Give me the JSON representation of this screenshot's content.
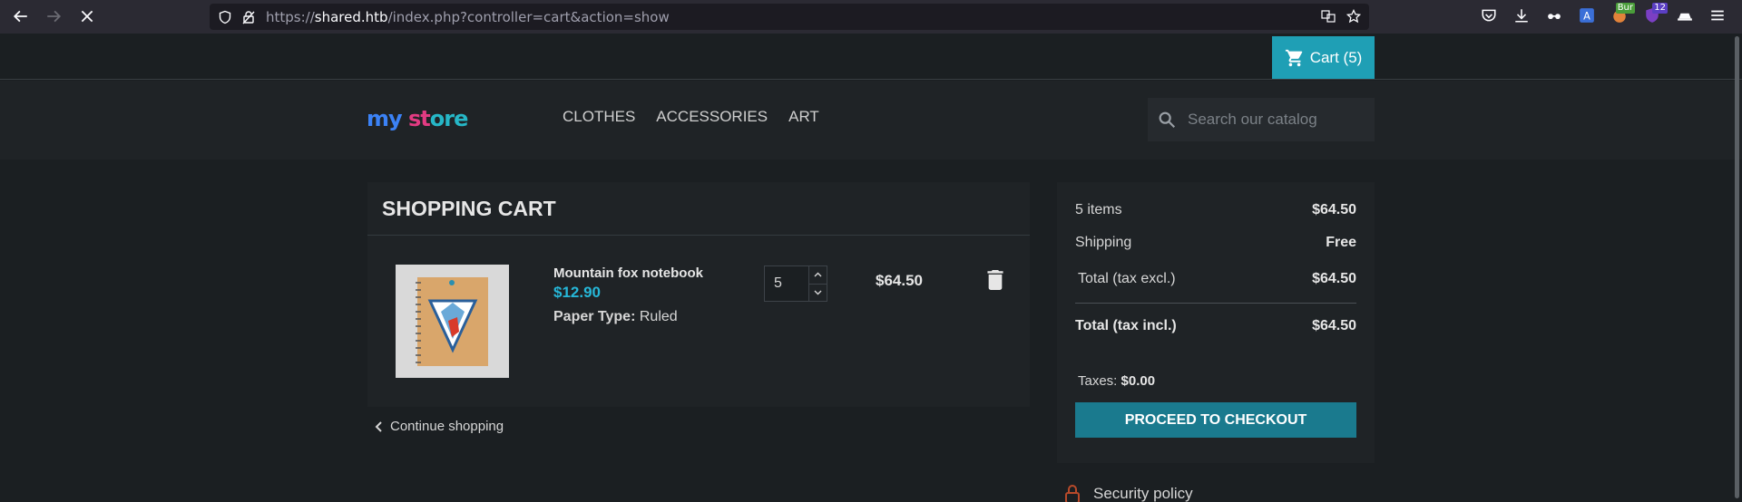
{
  "browser": {
    "url_prefix": "https://",
    "url_host": "shared.htb",
    "url_path": "/index.php?controller=cart&action=show",
    "ext_badge_bur": "Bur",
    "ext_badge_count": "12"
  },
  "topbar": {
    "cart_label": "Cart (5)"
  },
  "header": {
    "logo": {
      "p1": "my",
      "p2": " ",
      "p3": "st",
      "p4": "ore"
    },
    "menu": [
      "CLOTHES",
      "ACCESSORIES",
      "ART"
    ],
    "search_placeholder": "Search our catalog"
  },
  "cart": {
    "title": "SHOPPING CART",
    "item": {
      "name": "Mountain fox notebook",
      "unit_price": "$12.90",
      "attr_label": "Paper Type:",
      "attr_value": "Ruled",
      "quantity": "5",
      "line_total": "$64.50"
    },
    "continue_label": "Continue shopping"
  },
  "summary": {
    "items_label": "5 items",
    "items_value": "$64.50",
    "shipping_label": "Shipping",
    "shipping_value": "Free",
    "excl_label": "Total (tax excl.)",
    "excl_value": "$64.50",
    "incl_label": "Total (tax incl.)",
    "incl_value": "$64.50",
    "taxes_label": "Taxes:",
    "taxes_value": "$0.00",
    "checkout_label": "PROCEED TO CHECKOUT"
  },
  "reassurance": {
    "security_label": "Security policy"
  },
  "colors": {
    "accent": "#1f9fb5",
    "checkout": "#1a7a8e",
    "price": "#26b7d8"
  }
}
